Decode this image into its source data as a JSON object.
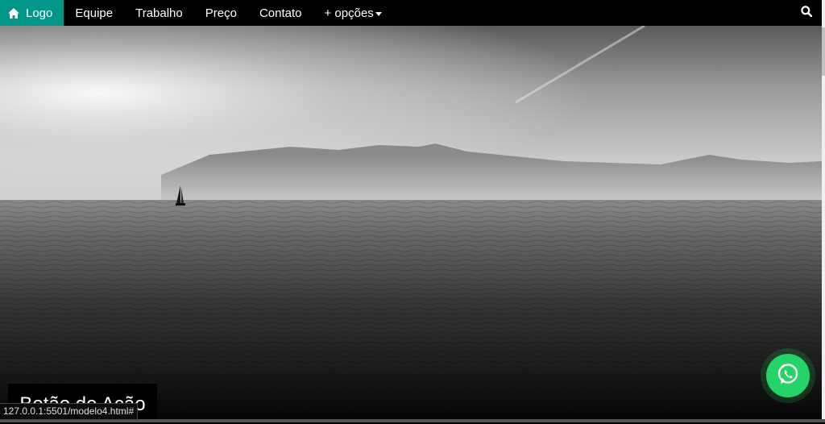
{
  "nav": {
    "logo_label": "Logo",
    "items": [
      {
        "label": "Equipe"
      },
      {
        "label": "Trabalho"
      },
      {
        "label": "Preço"
      },
      {
        "label": "Contato"
      }
    ],
    "dropdown_label": "+ opções",
    "active_color": "#009688",
    "icons": {
      "logo": "home-icon",
      "dropdown": "caret-down-icon",
      "search": "search-icon"
    }
  },
  "hero": {
    "image": "grayscale seascape with sailboat and mountains",
    "cta_label": "Botão de Ação"
  },
  "floating": {
    "whatsapp_icon": "whatsapp-icon",
    "whatsapp_color": "#25d366"
  },
  "status_bar": {
    "url": "127.0.0.1:5501/modelo4.html#"
  }
}
